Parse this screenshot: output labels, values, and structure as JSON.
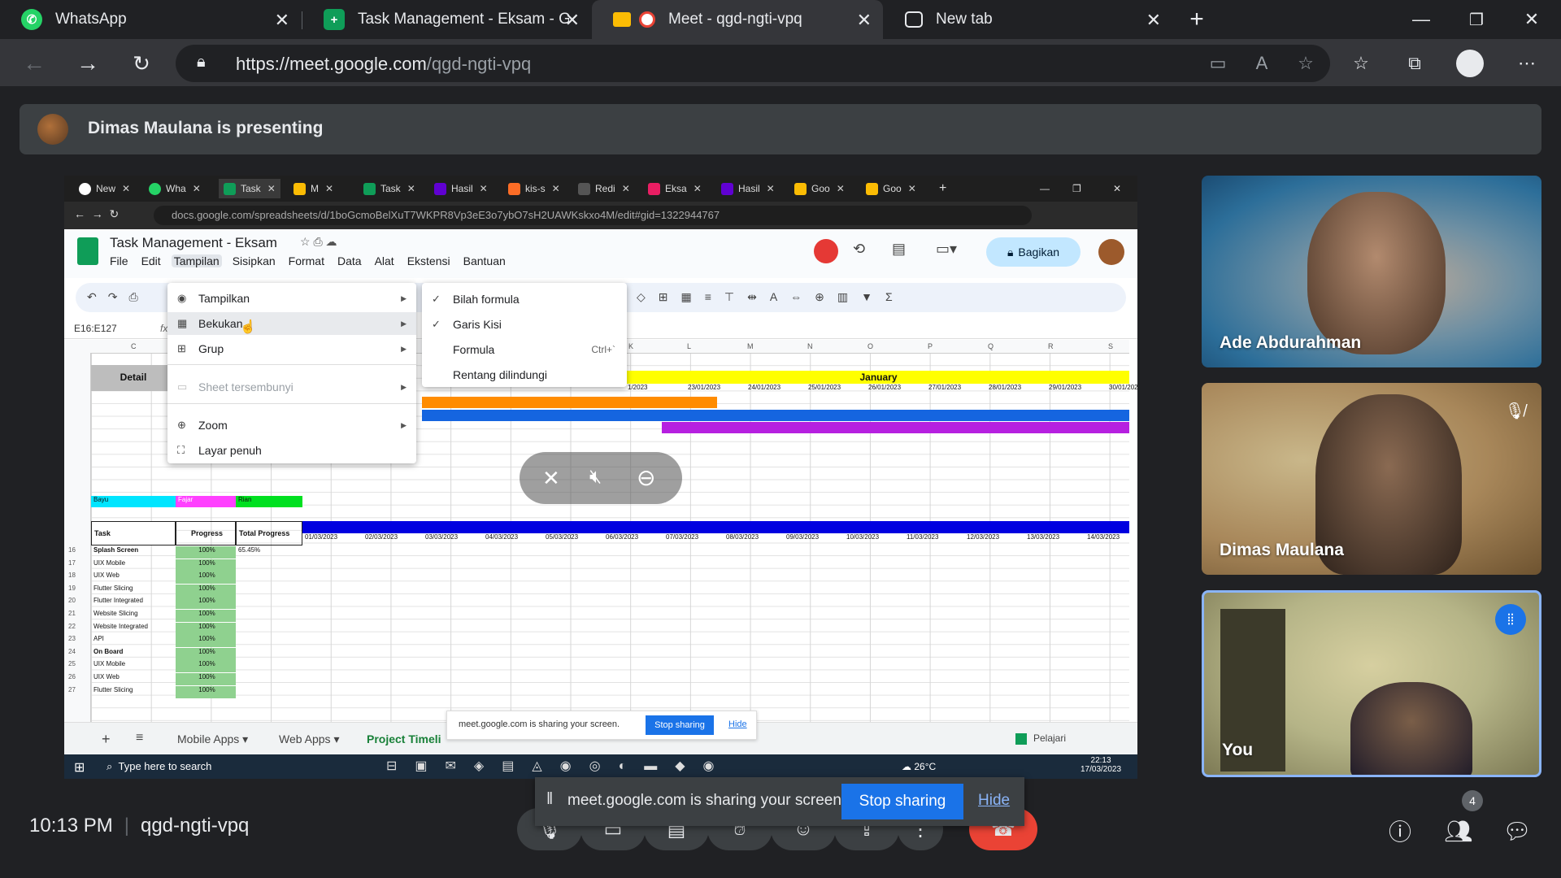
{
  "browser": {
    "tabs": [
      {
        "title": "WhatsApp",
        "icon": "whatsapp-icon",
        "color": "#25d366"
      },
      {
        "title": "Task Management - Eksam - Goo",
        "icon": "sheets-icon",
        "color": "#0f9d58"
      },
      {
        "title": "Meet - qgd-ngti-vpq",
        "icon": "meet-icon",
        "color": "#ea4335"
      },
      {
        "title": "New tab",
        "icon": "newtab-icon",
        "color": "#9aa0a6"
      }
    ],
    "url_domain": "https://meet.google.com",
    "url_path": "/qgd-ngti-vpq"
  },
  "banner": {
    "text": "Dimas Maulana is presenting"
  },
  "shared_screen": {
    "inner_tabs": [
      "New",
      "Wha",
      "Task",
      "M",
      "Task",
      "Hasil",
      "kis-s",
      "Redi",
      "Eksa",
      "Hasil",
      "Goo",
      "Goo"
    ],
    "inner_url": "docs.google.com/spreadsheets/d/1boGcmoBelXuT7WKPR8Vp3eE3o7ybO7sH2UAWKskxo4M/edit#gid=1322944767",
    "doc_title": "Task Management - Eksam",
    "menu": [
      "File",
      "Edit",
      "Tampilan",
      "Sisipkan",
      "Format",
      "Data",
      "Alat",
      "Ekstensi",
      "Bantuan"
    ],
    "share_label": "Bagikan",
    "cell_ref": "E16:E127",
    "view_menu": [
      "Tampilkan",
      "Bekukan",
      "Grup",
      "Sheet tersembunyi",
      "Zoom",
      "Layar penuh"
    ],
    "submenu": [
      {
        "label": "Bilah formula",
        "checked": true
      },
      {
        "label": "Garis Kisi",
        "checked": true
      },
      {
        "label": "Formula",
        "checked": false,
        "shortcut": "Ctrl+`"
      },
      {
        "label": "Rentang dilindungi",
        "checked": false
      }
    ],
    "columns": [
      "C",
      "K",
      "L",
      "M",
      "N",
      "O",
      "P",
      "Q",
      "R",
      "S"
    ],
    "month": "January",
    "jan_dates": [
      "1/2023",
      "23/01/2023",
      "24/01/2023",
      "25/01/2023",
      "26/01/2023",
      "27/01/2023",
      "28/01/2023",
      "29/01/2023",
      "30/01/2023"
    ],
    "march_dates": [
      "01/03/2023",
      "02/03/2023",
      "03/03/2023",
      "04/03/2023",
      "05/03/2023",
      "06/03/2023",
      "07/03/2023",
      "08/03/2023",
      "09/03/2023",
      "10/03/2023",
      "11/03/2023",
      "12/03/2023",
      "13/03/2023",
      "14/03/2023"
    ],
    "detail_label": "Detail",
    "people": [
      "Bayu",
      "Fajar",
      "Rian"
    ],
    "headers": {
      "task": "Task",
      "progress": "Progress",
      "total": "Total Progress"
    },
    "total_value": "65.45%",
    "rows": [
      {
        "n": "16",
        "task": "Splash Screen",
        "p": "100%",
        "bold": true
      },
      {
        "n": "17",
        "task": "UIX Mobile",
        "p": "100%"
      },
      {
        "n": "18",
        "task": "UIX Web",
        "p": "100%"
      },
      {
        "n": "19",
        "task": "Flutter Slicing",
        "p": "100%"
      },
      {
        "n": "20",
        "task": "Flutter Integrated",
        "p": "100%"
      },
      {
        "n": "21",
        "task": "Website Slicing",
        "p": "100%"
      },
      {
        "n": "22",
        "task": "Website Integrated",
        "p": "100%"
      },
      {
        "n": "23",
        "task": "API",
        "p": "100%"
      },
      {
        "n": "24",
        "task": "On Board",
        "p": "100%",
        "bold": true
      },
      {
        "n": "25",
        "task": "UIX Mobile",
        "p": "100%"
      },
      {
        "n": "26",
        "task": "UIX Web",
        "p": "100%"
      },
      {
        "n": "27",
        "task": "Flutter Slicing",
        "p": "100%"
      }
    ],
    "sheet_tabs": [
      "Mobile Apps",
      "Web Apps",
      "Project Timeli"
    ],
    "mini_share_text": "meet.google.com is sharing your screen.",
    "mini_stop": "Stop sharing",
    "mini_hide": "Hide",
    "learn": "Pelajari",
    "taskbar_search": "Type here to search",
    "weather": "26°C",
    "clock_time": "22:13",
    "clock_date": "17/03/2023"
  },
  "participants": [
    {
      "name": "Ade Abdurahman",
      "muted": false
    },
    {
      "name": "Dimas Maulana",
      "muted": true
    },
    {
      "name": "You",
      "speaking": true
    }
  ],
  "bottom": {
    "time": "10:13 PM",
    "meeting_code": "qgd-ngti-vpq",
    "people_count": "4"
  },
  "share_banner": {
    "text": "meet.google.com is sharing your screen.",
    "stop": "Stop sharing",
    "hide": "Hide"
  }
}
